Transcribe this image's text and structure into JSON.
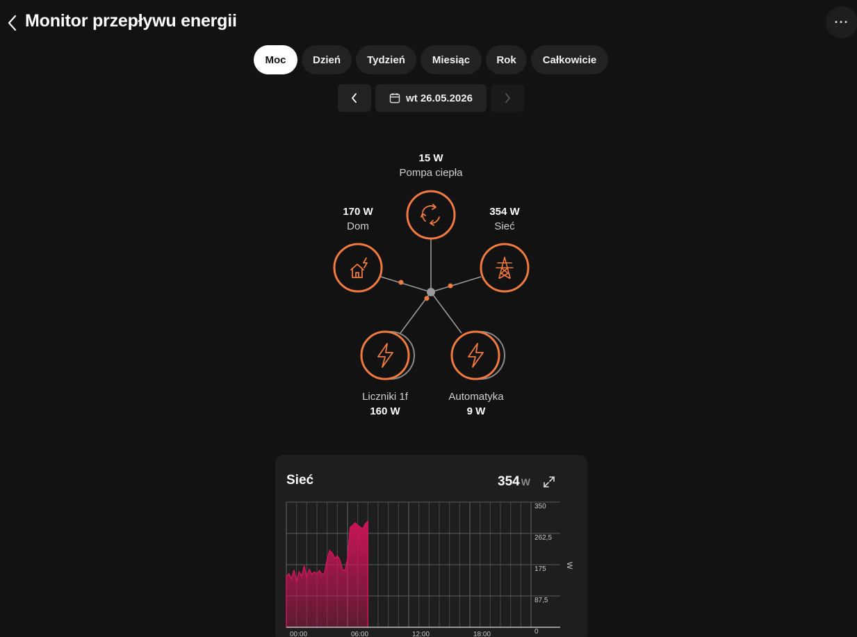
{
  "header": {
    "title": "Monitor przepływu energii",
    "more_label": "···"
  },
  "tabs": [
    {
      "label": "Moc",
      "active": true
    },
    {
      "label": "Dzień",
      "active": false
    },
    {
      "label": "Tydzień",
      "active": false
    },
    {
      "label": "Miesiąc",
      "active": false
    },
    {
      "label": "Rok",
      "active": false
    },
    {
      "label": "Całkowicie",
      "active": false
    }
  ],
  "date_nav": {
    "date": "wt 26.05.2026",
    "next_enabled": false
  },
  "flow": {
    "accent_color": "#f07a3f",
    "nodes": {
      "heat_pump": {
        "value": "15 W",
        "name": "Pompa ciepła",
        "icon": "recycle-icon"
      },
      "home": {
        "value": "170 W",
        "name": "Dom",
        "icon": "house-energy-icon"
      },
      "grid": {
        "value": "354 W",
        "name": "Sieć",
        "icon": "power-tower-icon"
      },
      "meters": {
        "value": "160 W",
        "name": "Liczniki 1f",
        "icon": "lightning-icon"
      },
      "automation": {
        "value": "9 W",
        "name": "Automatyka",
        "icon": "lightning-icon"
      }
    }
  },
  "card": {
    "title": "Sieć",
    "value": "354",
    "unit": "W"
  },
  "chart_data": {
    "type": "area",
    "series": [
      {
        "color": "#d1145a",
        "x": [
          0,
          0.25,
          0.5,
          0.75,
          1,
          1.25,
          1.5,
          1.75,
          2,
          2.25,
          2.5,
          2.75,
          3,
          3.25,
          3.5,
          3.75,
          4,
          4.25,
          4.5,
          4.75,
          5,
          5.25,
          5.5,
          5.75,
          6,
          6.25,
          6.5,
          6.75,
          7,
          7.25,
          7.5,
          7.75,
          8
        ],
        "values": [
          140,
          150,
          135,
          160,
          128,
          155,
          142,
          172,
          140,
          162,
          148,
          155,
          150,
          158,
          148,
          152,
          190,
          215,
          208,
          192,
          200,
          188,
          162,
          158,
          192,
          278,
          285,
          292,
          285,
          280,
          275,
          290,
          296
        ]
      }
    ],
    "xlim": [
      0,
      24
    ],
    "ylim": [
      0,
      350
    ],
    "xticks": [
      "00:00",
      "06:00",
      "12:00",
      "18:00"
    ],
    "yticks": [
      "350",
      "262,5",
      "175",
      "87,5",
      "0"
    ],
    "ylabel": "W",
    "grid": true
  }
}
